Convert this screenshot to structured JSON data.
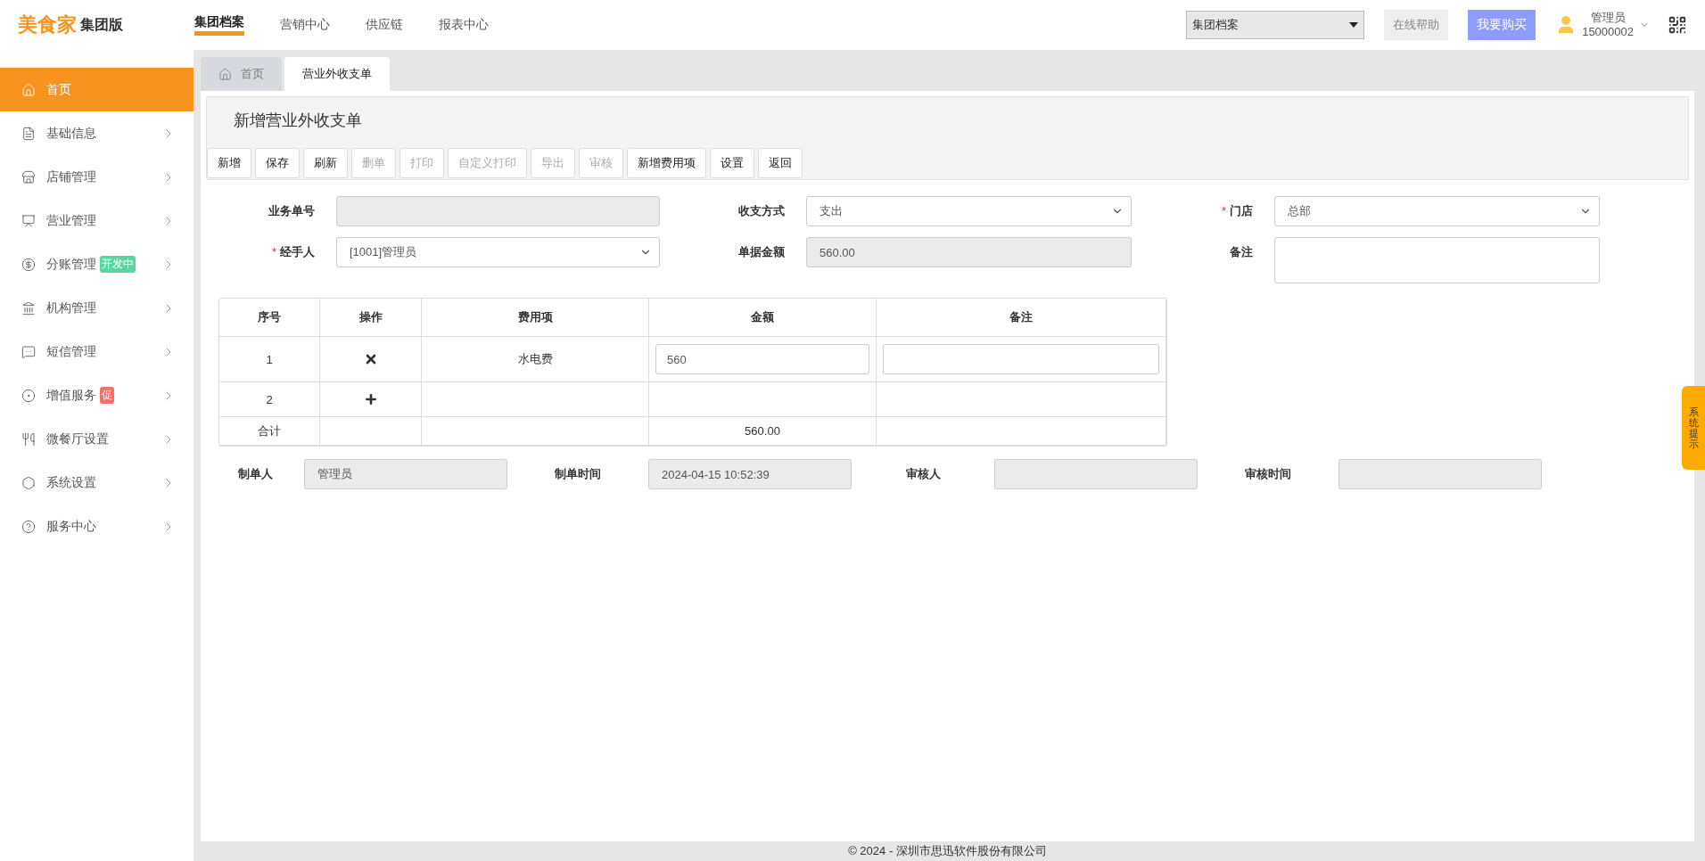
{
  "header": {
    "logo": "美食家",
    "edition": "集团版",
    "nav": [
      {
        "label": "集团档案",
        "selected": true
      },
      {
        "label": "营销中心",
        "selected": false
      },
      {
        "label": "供应链",
        "selected": false
      },
      {
        "label": "报表中心",
        "selected": false
      }
    ],
    "org_select": "集团档案",
    "help_button": "在线帮助",
    "buy_button": "我要购买",
    "user": {
      "role": "管理员",
      "account": "15000002"
    }
  },
  "sidebar": {
    "items": [
      {
        "label": "首页",
        "selected": true
      },
      {
        "label": "基础信息",
        "selected": false
      },
      {
        "label": "店铺管理",
        "selected": false
      },
      {
        "label": "营业管理",
        "selected": false
      },
      {
        "label": "分账管理",
        "selected": false,
        "badge": "开发中",
        "color": "#5cd6a0"
      },
      {
        "label": "机构管理",
        "selected": false
      },
      {
        "label": "短信管理",
        "selected": false
      },
      {
        "label": "增值服务",
        "selected": false,
        "badge": "促",
        "color": "#f4716a"
      },
      {
        "label": "微餐厅设置",
        "selected": false
      },
      {
        "label": "系统设置",
        "selected": false
      },
      {
        "label": "服务中心",
        "selected": false
      }
    ]
  },
  "tabs": [
    {
      "label": "首页",
      "selected": false
    },
    {
      "label": "营业外收支单",
      "selected": true
    }
  ],
  "form": {
    "title": "新增营业外收支单",
    "toolbar": [
      {
        "label": "新增",
        "disabled": false
      },
      {
        "label": "保存",
        "disabled": false
      },
      {
        "label": "刷新",
        "disabled": false
      },
      {
        "label": "删单",
        "disabled": true
      },
      {
        "label": "打印",
        "disabled": true
      },
      {
        "label": "自定义打印",
        "disabled": true
      },
      {
        "label": "导出",
        "disabled": true
      },
      {
        "label": "审核",
        "disabled": true
      },
      {
        "label": "新增费用项",
        "disabled": false
      },
      {
        "label": "设置",
        "disabled": false
      },
      {
        "label": "返回",
        "disabled": false
      }
    ],
    "fields": [
      {
        "label": "业务单号",
        "kind": "readonly"
      },
      {
        "label": "收支方式",
        "kind": "select",
        "value": "支出"
      },
      {
        "label": "门店",
        "kind": "select",
        "value": "总部",
        "required_mark": "*"
      },
      {
        "label": "经手人",
        "kind": "select",
        "value": "[1001]管理员",
        "required_mark": "*"
      },
      {
        "label": "单据金额",
        "kind": "readonly",
        "value": "560.00"
      },
      {
        "label": "备注",
        "kind": "textarea"
      }
    ],
    "table": {
      "columns": [
        "序号",
        "操作",
        "费用项",
        "金额",
        "备注"
      ],
      "rows": [
        {
          "no": "1",
          "kind": "delete",
          "item": "水电费",
          "amount": "560"
        },
        {
          "no": "2",
          "kind": "add"
        }
      ],
      "total": {
        "label": "合计",
        "amount": "560.00"
      }
    },
    "footer_fields": [
      {
        "label": "制单人",
        "value": "管理员"
      },
      {
        "label": "制单时间",
        "value": "2024-04-15 10:52:39"
      },
      {
        "label": "审核人"
      },
      {
        "label": "审核时间"
      }
    ]
  },
  "side_tab": "系统提示",
  "copyright": "© 2024 - 深圳市思迅软件股份有限公司"
}
